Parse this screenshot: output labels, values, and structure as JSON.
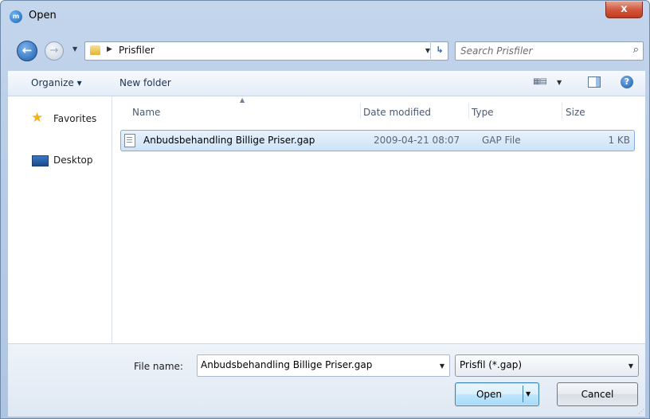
{
  "window": {
    "title": "Open",
    "close_glyph": "x"
  },
  "nav": {
    "back_glyph": "←",
    "forward_glyph": "→"
  },
  "address": {
    "path": "Prisfiler"
  },
  "search": {
    "placeholder": "Search Prisfiler"
  },
  "toolbar": {
    "organize": "Organize ▾",
    "new_folder": "New folder",
    "help_glyph": "?"
  },
  "sidebar": {
    "items": [
      {
        "label": "Favorites",
        "icon": "star-icon"
      },
      {
        "label": "Desktop",
        "icon": "desktop-icon"
      }
    ]
  },
  "file_list": {
    "columns": [
      "Name",
      "Date modified",
      "Type",
      "Size"
    ],
    "rows": [
      {
        "name": "Anbudsbehandling Billige Priser.gap",
        "date_modified": "2009-04-21 08:07",
        "type": "GAP File",
        "size": "1 KB",
        "selected": true
      }
    ]
  },
  "footer": {
    "file_name_label": "File name:",
    "file_name_value": "Anbudsbehandling Billige Priser.gap",
    "filter": "Prisfil (*.gap)",
    "open": "Open",
    "cancel": "Cancel"
  },
  "colors": {
    "accent": "#3c7fb1",
    "selection": "#cde3f8",
    "chrome": "#b6cbe6"
  }
}
